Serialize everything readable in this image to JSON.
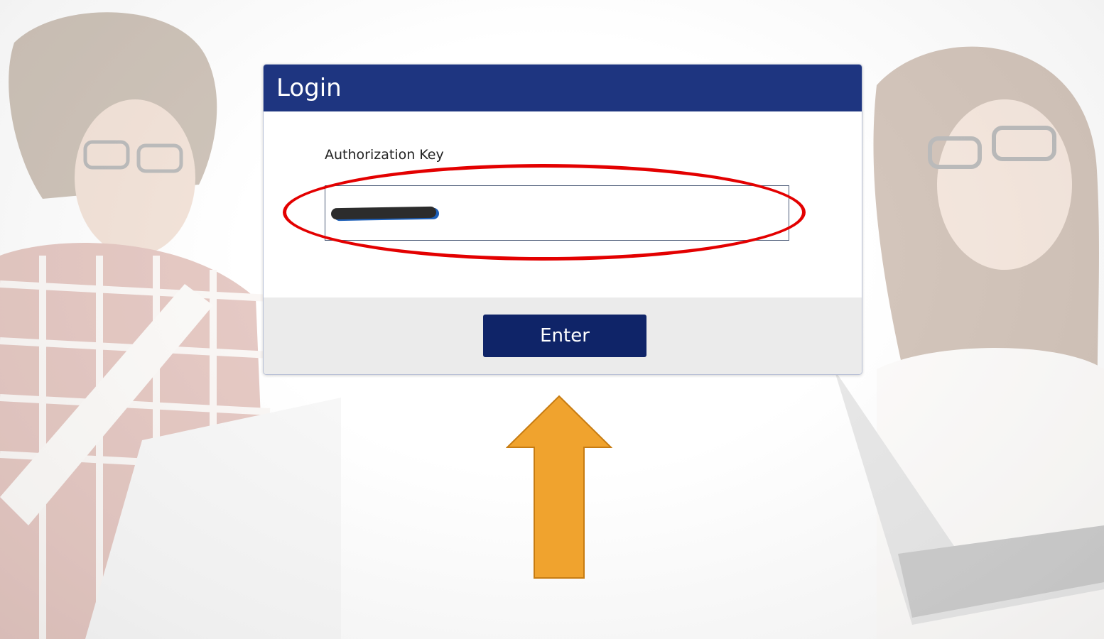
{
  "dialog": {
    "title": "Login",
    "field_label": "Authorization Key",
    "key_value": "",
    "enter_label": "Enter"
  },
  "colors": {
    "header": "#1e3580",
    "button": "#0f2468",
    "annotation_ellipse": "#e30000",
    "annotation_arrow": "#f0a32e"
  },
  "annotations": {
    "ellipse": "red-ellipse-highlighting-key-input",
    "arrow": "orange-up-arrow-pointing-to-enter-button"
  },
  "background": {
    "left_image": "faded-photo-man-with-glasses-laptop",
    "right_image": "faded-photo-woman-with-glasses-laptop"
  }
}
